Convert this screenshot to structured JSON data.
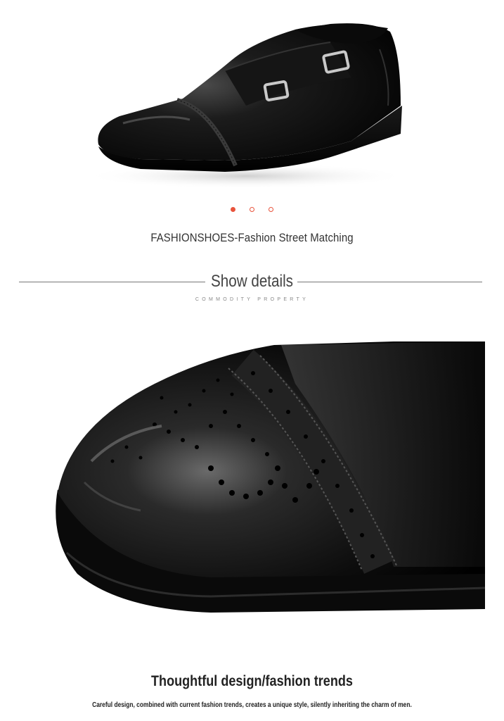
{
  "product": {
    "hero_image": "black-double-monk-strap-brogue-shoe",
    "carousel": {
      "count": 3,
      "active_index": 0,
      "accent_color": "#e8533c"
    },
    "subtitle": "FASHIONSHOES-Fashion Street Matching"
  },
  "section": {
    "title": "Show details",
    "subtitle": "COMMODITY PROPERTY"
  },
  "detail": {
    "image": "brogue-toe-cap-closeup"
  },
  "footer": {
    "title": "Thoughtful design/fashion trends",
    "text": "Careful design, combined with current fashion trends, creates a unique style, silently inheriting the charm of men."
  }
}
